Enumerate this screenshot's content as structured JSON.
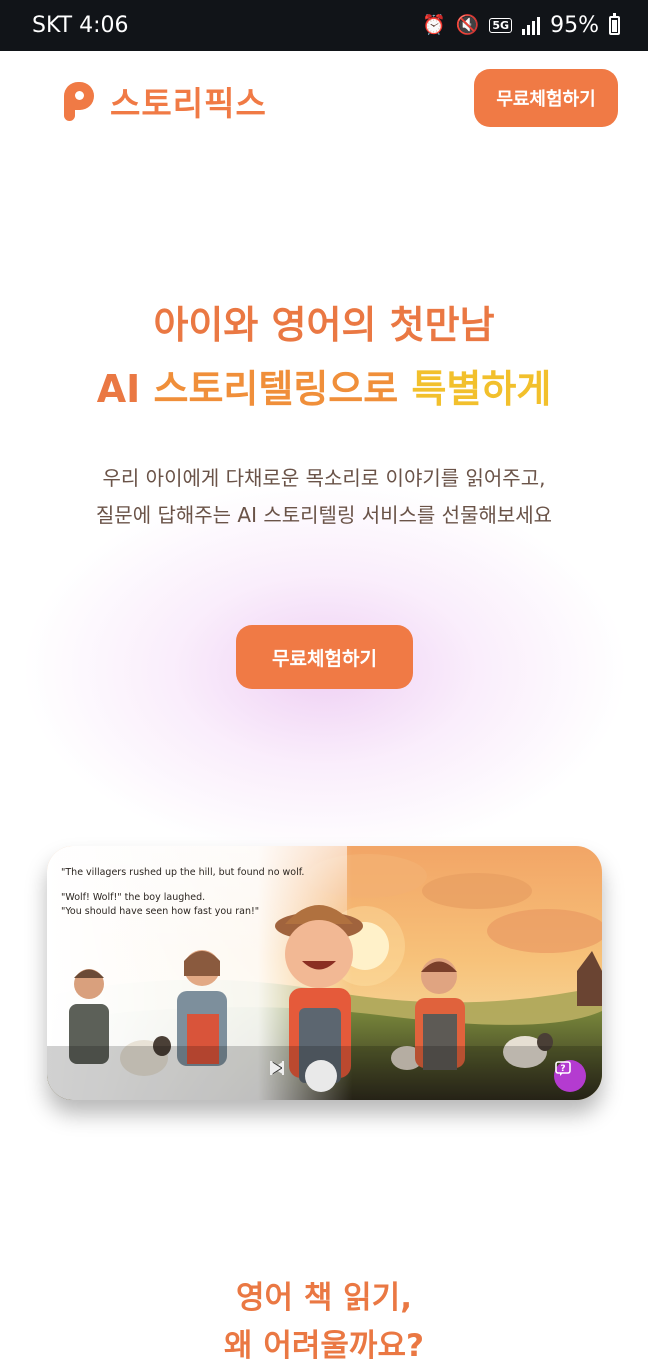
{
  "status_bar": {
    "carrier_time": "SKT 4:06",
    "network": "5G",
    "battery": "95%",
    "icons": [
      "alarm-icon",
      "mute-icon",
      "5g-icon",
      "signal-icon",
      "battery-icon"
    ]
  },
  "header": {
    "logo_text": "스토리픽스",
    "cta_label": "무료체험하기"
  },
  "hero": {
    "title_line1": "아이와 영어의 첫만남",
    "title_line2_ai": "AI",
    "title_line2_mid": " 스토리텔링으로 ",
    "title_line2_highlight": "특별하게",
    "subtitle_line1": "우리 아이에게 다채로운 목소리로 이야기를 읽어주고,",
    "subtitle_line2": "질문에 답해주는 AI 스토리텔링 서비스를 선물해보세요",
    "cta_label": "무료체험하기"
  },
  "preview": {
    "story_line1": "\"The villagers rushed up the hill, but found no wolf.",
    "story_line2": "\"Wolf! Wolf!\" the boy laughed.",
    "story_line3": "\"You should have seen how fast you ran!\"",
    "controls": [
      "previous-icon",
      "play-icon",
      "next-icon"
    ],
    "qa_icon": "question-bubble-icon"
  },
  "section": {
    "title_line1": "영어 책 읽기,",
    "title_line2": "왜 어려울까요?"
  },
  "colors": {
    "brand_orange": "#f07a45",
    "highlight_yellow": "#f2c02c",
    "body_text": "#6a5348",
    "qa_purple": "#b43bd0"
  }
}
